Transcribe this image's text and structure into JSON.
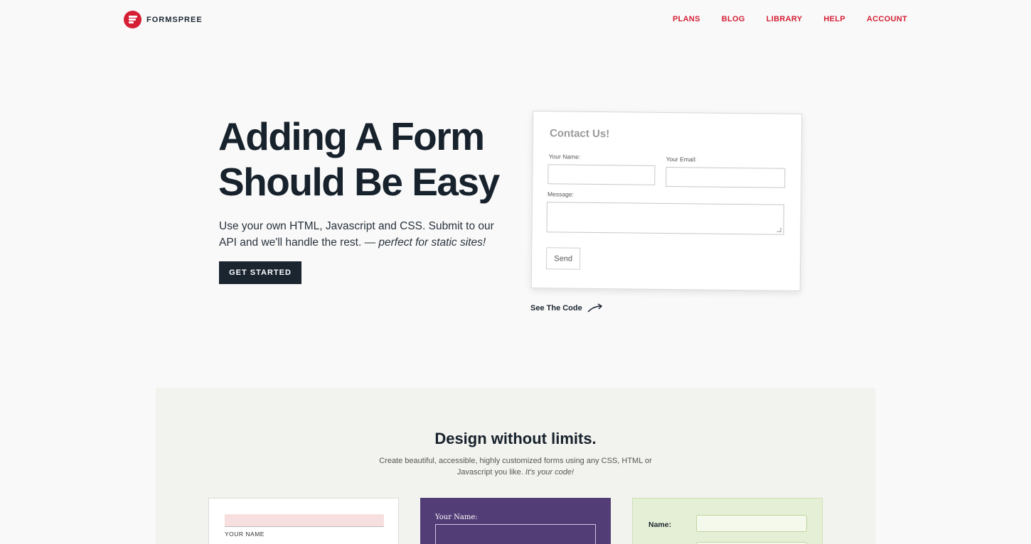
{
  "brand": {
    "name": "FORMSPREE",
    "logo_color": "#d51f35"
  },
  "nav": {
    "items": [
      {
        "label": "PLANS"
      },
      {
        "label": "BLOG"
      },
      {
        "label": "LIBRARY"
      },
      {
        "label": "HELP"
      },
      {
        "label": "ACCOUNT"
      }
    ],
    "color": "#d51f35"
  },
  "hero": {
    "title_line1": "Adding A Form",
    "title_line2": "Should Be Easy",
    "subtitle": "Use your own HTML, Javascript and CSS. Submit to our API and we'll handle the rest.",
    "subtitle_em": "— perfect for static sites!",
    "cta_label": "GET STARTED"
  },
  "demo_form": {
    "title": "Contact Us!",
    "name_label": "Your Name:",
    "email_label": "Your Email:",
    "message_label": "Message:",
    "send_label": "Send",
    "see_code_label": "See The Code"
  },
  "design_section": {
    "title": "Design without limits.",
    "subtitle": "Create beautiful, accessible, highly customized forms using any CSS, HTML or Javascript you like.",
    "subtitle_em": "It's your code!",
    "samples": [
      {
        "label": "YOUR NAME",
        "bg": "#ffffff"
      },
      {
        "label": "Your Name:",
        "bg": "#533d77"
      },
      {
        "label": "Name:",
        "bg": "#e5efd5"
      }
    ]
  }
}
